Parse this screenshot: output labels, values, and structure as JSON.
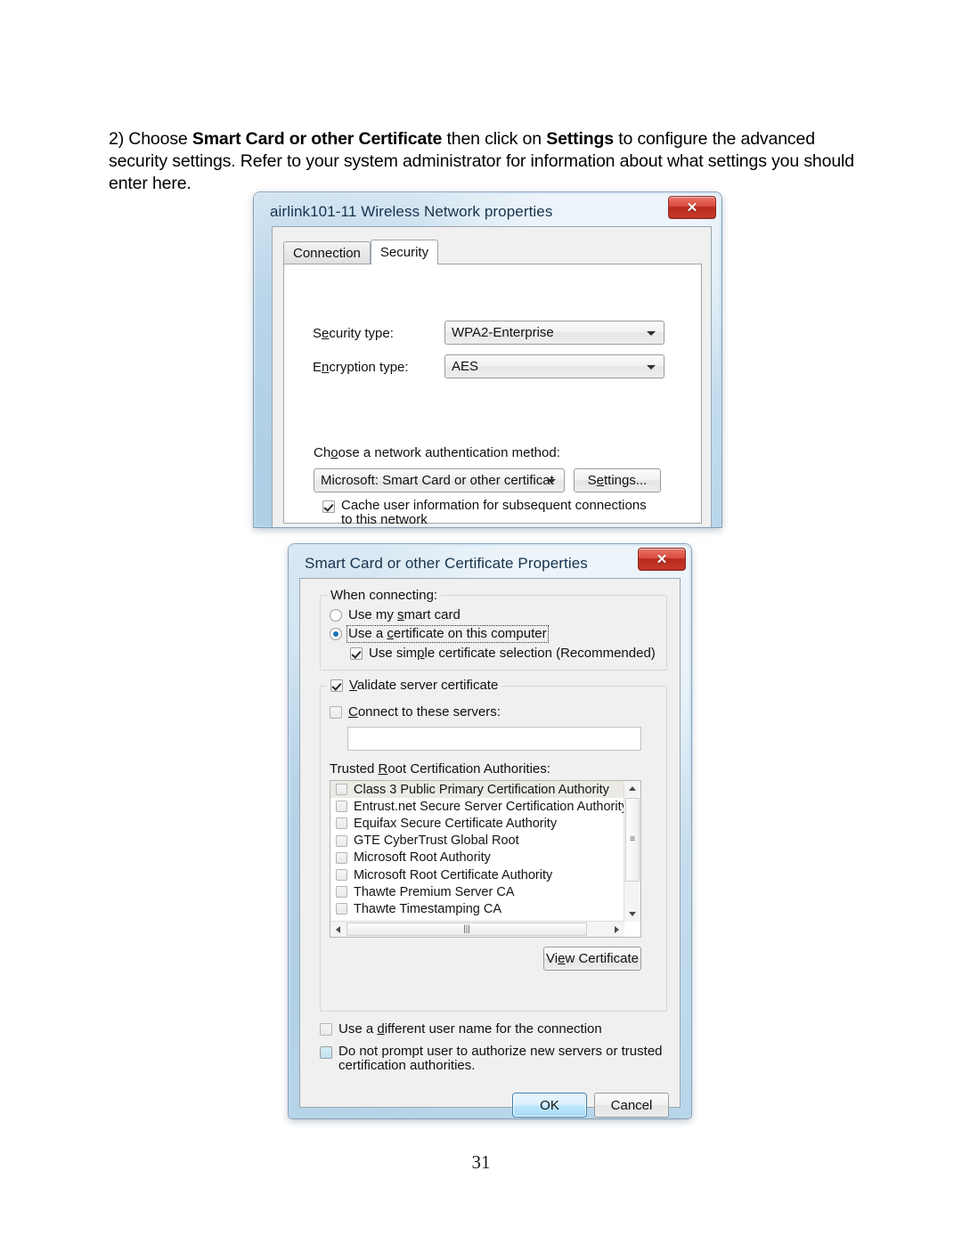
{
  "document": {
    "step_prefix": "2) Choose ",
    "bold_1": "Smart Card or other Certificate",
    "mid_1": " then click on ",
    "bold_2": "Settings",
    "tail": " to configure the advanced security settings. Refer to your system administrator for information about what settings you should enter here.",
    "page_number": "31"
  },
  "wireless_dialog": {
    "title": "airlink101-11 Wireless Network properties",
    "close_glyph": "✕",
    "tabs": [
      {
        "label": "Connection",
        "active": false
      },
      {
        "label": "Security",
        "active": true
      }
    ],
    "security_type_label": "Security type:",
    "security_type_value": "WPA2-Enterprise",
    "encryption_type_label": "Encryption type:",
    "encryption_type_value": "AES",
    "auth_method_label": "Choose a network authentication method:",
    "auth_method_value": "Microsoft: Smart Card or other certificat",
    "settings_button": "Settings...",
    "cache_checkbox": {
      "line1": "Cache user information for subsequent connections",
      "line2": "to this network",
      "checked": true
    }
  },
  "cert_dialog": {
    "title": "Smart Card or other Certificate Properties",
    "close_glyph": "✕",
    "when_connecting_label": "When connecting:",
    "radio_smart_card": {
      "label": "Use my smart card",
      "selected": false
    },
    "radio_certificate": {
      "label": "Use a certificate on this computer",
      "selected": true
    },
    "checkbox_simple_selection": {
      "label": "Use simple certificate selection (Recommended)",
      "checked": true
    },
    "checkbox_validate_server": {
      "label": "Validate server certificate",
      "checked": true
    },
    "checkbox_connect_servers": {
      "label": "Connect to these servers:",
      "checked": false
    },
    "servers_input_value": "",
    "trusted_root_label": "Trusted Root Certification Authorities:",
    "trusted_root_items": [
      {
        "label": "Class 3 Public Primary Certification Authority",
        "checked": false,
        "highlighted": true
      },
      {
        "label": "Entrust.net Secure Server Certification Authority",
        "checked": false,
        "highlighted": false
      },
      {
        "label": "Equifax Secure Certificate Authority",
        "checked": false,
        "highlighted": false
      },
      {
        "label": "GTE CyberTrust Global Root",
        "checked": false,
        "highlighted": false
      },
      {
        "label": "Microsoft Root Authority",
        "checked": false,
        "highlighted": false
      },
      {
        "label": "Microsoft Root Certificate Authority",
        "checked": false,
        "highlighted": false
      },
      {
        "label": "Thawte Premium Server CA",
        "checked": false,
        "highlighted": false
      },
      {
        "label": "Thawte Timestamping CA",
        "checked": false,
        "highlighted": false
      }
    ],
    "scroll_grip": "≡",
    "hscroll_grip": "‖",
    "view_certificate_button": "View Certificate",
    "checkbox_different_username": {
      "label": "Use a different user name for the connection",
      "checked": false
    },
    "checkbox_do_not_prompt": {
      "line1": "Do not prompt user to authorize new servers or trusted",
      "line2": "certification authorities.",
      "checked": false
    },
    "ok_button": "OK",
    "cancel_button": "Cancel"
  },
  "colors": {
    "aero_frame": "#c4ddee",
    "close_red": "#c9392a",
    "default_button_blue": "#bee6fd",
    "radio_dot": "#1a74b8",
    "client_gray": "#f0f0f0"
  }
}
